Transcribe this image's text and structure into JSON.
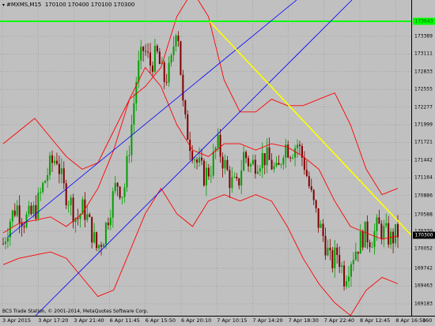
{
  "header": {
    "icon": "chart-collapse-icon",
    "symbol": "#MXMS,M15",
    "ohlc": "170100 170400 170100 170300"
  },
  "copyright": "BCS Trade Station, © 2001-2014, MetaQuotes Software Corp.",
  "price_axis": {
    "labels": [
      "173389",
      "173111",
      "172833",
      "172555",
      "172277",
      "171999",
      "171721",
      "171442",
      "171164",
      "170886",
      "170588",
      "170330",
      "170052",
      "169742",
      "169463",
      "169183"
    ],
    "current_price": "170300",
    "green_line_price": "173643",
    "green_line_color": "#00ff00",
    "current_tag_color": "#000000"
  },
  "time_axis": {
    "labels": [
      "3 Apr 2015",
      "3 Apr 17:20",
      "3 Apr 21:40",
      "6 Apr 11:45",
      "6 Apr 15:50",
      "6 Apr 20:10",
      "7 Apr 10:15",
      "7 Apr 14:20",
      "7 Apr 18:30",
      "7 Apr 22:40",
      "8 Apr 12:45",
      "8 Apr 16:50"
    ],
    "corner_label": "160"
  },
  "colors": {
    "chart_bg": "#c0c0c0",
    "grid": "#8f8f8f",
    "bull_candle": "#00a000",
    "bear_candle": "#800000",
    "bands": "#ff0000",
    "channel": "#0000ff",
    "trendline": "#ffff00"
  },
  "chart_data": {
    "type": "candlestick",
    "instrument": "#MXMS,M15",
    "close_path": [
      170130,
      170500,
      170730,
      170500,
      170550,
      170700,
      171050,
      171350,
      171500,
      171000,
      170800,
      170500,
      170700,
      170400,
      170050,
      170250,
      170700,
      171100,
      170900,
      171800,
      172800,
      173200,
      172950,
      173100,
      172700,
      172850,
      173700,
      172100,
      171700,
      171400,
      171200,
      171300,
      171700,
      171400,
      171100,
      171000,
      171550,
      171350,
      171450,
      171500,
      171400,
      171200,
      171700,
      171600,
      171700,
      171400,
      170900,
      170500,
      170200,
      169800,
      170000,
      169600,
      169900,
      170100,
      170300,
      170200,
      170400,
      170300,
      170200,
      170300
    ],
    "bollinger_upper": [
      171700,
      171900,
      172100,
      171800,
      171500,
      171300,
      171400,
      171900,
      172400,
      172600,
      172900,
      173700,
      174100,
      173700,
      172700,
      172200,
      172200,
      172400,
      172300,
      172300,
      172400,
      172500,
      172000,
      171300,
      170900,
      171000
    ],
    "bollinger_middle": [
      170300,
      170450,
      170500,
      170550,
      170400,
      170600,
      171000,
      171600,
      172400,
      172900,
      172600,
      172000,
      171600,
      171500,
      171700,
      171700,
      171600,
      171700,
      171650,
      171500,
      171300,
      170800,
      170400,
      170300,
      170200,
      170250
    ],
    "bollinger_lower": [
      169800,
      169900,
      169950,
      170000,
      169900,
      169600,
      169300,
      169400,
      170000,
      170600,
      171000,
      170600,
      170400,
      170800,
      170900,
      170800,
      170900,
      170800,
      170400,
      169900,
      169500,
      169200,
      169000,
      169400,
      169600,
      169500
    ]
  }
}
